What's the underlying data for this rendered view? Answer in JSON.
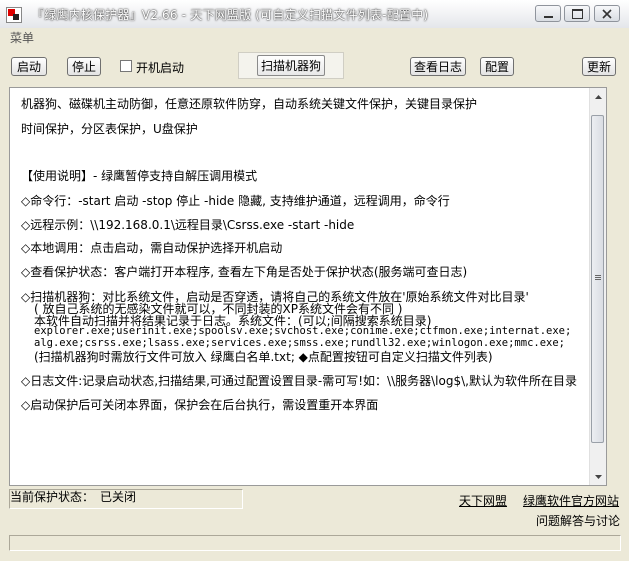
{
  "window": {
    "title": "『绿鹰内核保护器』V2.66 - 天下网盟版 (可自定义扫描文件列表-配置中)",
    "controls": [
      "minimize-icon",
      "restore-icon",
      "close-icon"
    ]
  },
  "menu": {
    "label": "菜单"
  },
  "toolbar": {
    "start": "启动",
    "stop": "停止",
    "autostart": "开机启动",
    "scan": "扫描机器狗",
    "view_log": "查看日志",
    "config": "配置",
    "update": "更新"
  },
  "content": {
    "lines": [
      "机器狗、磁碟机主动防御，任意还原软件防穿，自动系统关键文件保护，关键目录保护",
      "时间保护，分区表保护，U盘保护",
      "【使用说明】- 绿鹰暂停支持自解压调用模式",
      "◇命令行：-start 启动  -stop 停止 -hide 隐藏, 支持维护通道，远程调用，命令行",
      "◇远程示例：\\\\192.168.0.1\\远程目录\\Csrss.exe -start -hide",
      "◇本地调用：点击启动，需自动保护选择开机启动",
      "◇查看保护状态：客户端打开本程序, 查看左下角是否处于保护状态(服务端可查日志)",
      "◇扫描机器狗：对比系统文件，启动是否穿透，请将自己的系统文件放在'原始系统文件对比目录'",
      "( 放自己系统的无感染文件就可以，不同封装的XP系统文件会有不同 )",
      "本软件自动扫描并将结果记录于日志。系统文件：(可以;间隔搜索系统目录)",
      "explorer.exe;userinit.exe;spoolsv.exe;svchost.exe;conime.exe;ctfmon.exe;internat.exe;",
      "alg.exe;csrss.exe;lsass.exe;services.exe;smss.exe;rundll32.exe;winlogon.exe;mmc.exe;",
      "(扫描机器狗时需放行文件可放入 绿鹰白名单.txt; ◆点配置按钮可自定义扫描文件列表)",
      "◇日志文件:记录启动状态,扫描结果,可通过配置设置目录-需可写!如：\\\\服务器\\log$\\,默认为软件所在目录",
      "◇启动保护后可关闭本界面，保护会在后台执行，需设置重开本界面"
    ]
  },
  "status": {
    "label": "当前保护状态：",
    "value": "已关闭"
  },
  "links": {
    "tianxia": "天下网盟",
    "official": "绿鹰软件官方网站",
    "discussion": "问题解答与讨论"
  },
  "colors": {
    "window_bg": "#ece9d8",
    "text_bg": "#ffffff",
    "title_text": "#ffffff"
  }
}
